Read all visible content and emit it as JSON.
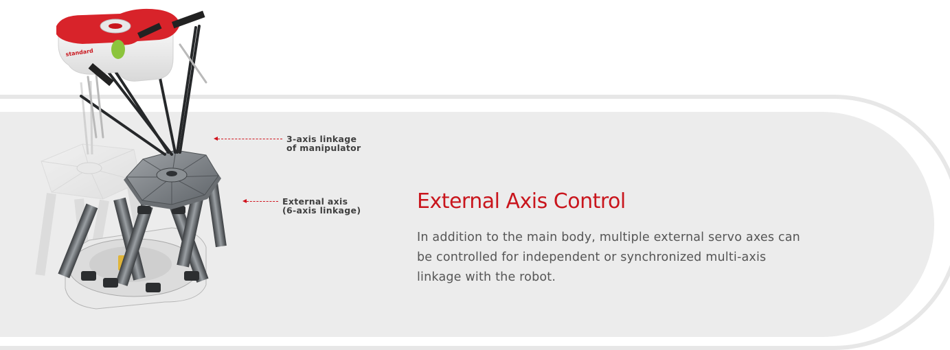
{
  "section": {
    "title": "External Axis Control",
    "description": "In addition to the main body, multiple external servo axes can be controlled for independent or synchronized multi-axis linkage with the robot."
  },
  "callouts": {
    "manipulator": "3-axis linkage\nof manipulator",
    "external": "External axis\n(6-axis linkage)"
  },
  "colors": {
    "accent": "#c9161d",
    "panel": "#ececec",
    "text": "#555555"
  },
  "icons": {
    "robot": "delta-robot-illustration"
  }
}
